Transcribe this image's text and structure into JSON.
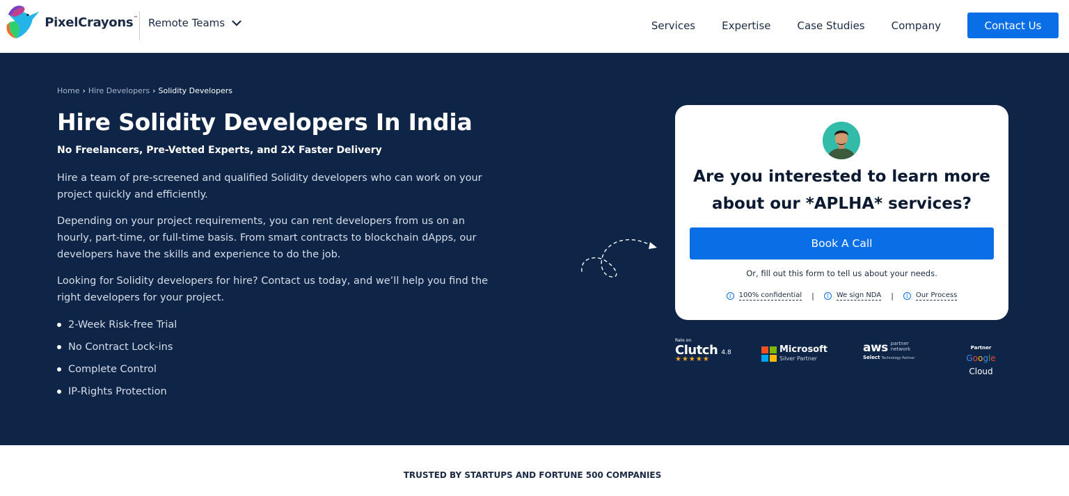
{
  "brand": {
    "name": "PixelCrayons",
    "tm": "™"
  },
  "header": {
    "team_select": "Remote Teams",
    "nav": [
      "Services",
      "Expertise",
      "Case Studies",
      "Company"
    ],
    "contact": "Contact Us"
  },
  "breadcrumb": {
    "home": "Home",
    "sep": "›",
    "hire": "Hire Developers",
    "current": "Solidity Developers"
  },
  "hero": {
    "title": "Hire Solidity Developers In India",
    "subtitle": "No Freelancers, Pre-Vetted Experts, and 2X Faster Delivery",
    "p1": "Hire a team of pre-screened and qualified Solidity developers who can work on your project quickly and efficiently.",
    "p2": "Depending on your project requirements, you can rent developers from us on an hourly, part-time, or full-time basis. From smart contracts to blockchain dApps, our developers have the skills and experience to do the job.",
    "p3": "Looking for Solidity developers for hire? Contact us today, and we’ll help you find the right developers for your project.",
    "bullets": [
      "2-Week Risk-free Trial",
      "No Contract Lock-ins",
      "Complete Control",
      "IP-Rights Protection"
    ]
  },
  "card": {
    "question": "Are you interested to learn more about our *APLHA* services?",
    "cta": "Book A Call",
    "or_text": "Or, fill out this form to tell us about your needs.",
    "links": [
      "100% confidential",
      "We sign NDA",
      "Our Process"
    ],
    "link_sep": "|",
    "info_glyph": "i"
  },
  "partners": {
    "clutch": {
      "rate": "Rate on",
      "name": "Clutch",
      "score": "4.8",
      "stars": "★★★★★"
    },
    "microsoft": {
      "name": "Microsoft",
      "tier": "Silver Partner",
      "colors": [
        "#f25022",
        "#7fba00",
        "#00a4ef",
        "#ffb900"
      ]
    },
    "aws": {
      "name": "aws",
      "line1": "partner",
      "line2": "network",
      "select": "Select",
      "select_tail": "Technology Partner"
    },
    "google": {
      "partner": "Partner",
      "name": "Google Cloud"
    }
  },
  "trusted": "TRUSTED BY STARTUPS AND FORTUNE 500 COMPANIES",
  "colors": {
    "navy": "#0f2547",
    "accent": "#0a6ee6",
    "white": "#ffffff"
  }
}
